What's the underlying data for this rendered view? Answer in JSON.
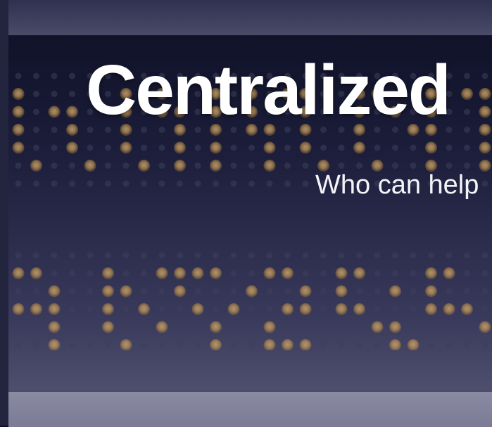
{
  "slide": {
    "title": "Centralized",
    "subtitle": "Who can help"
  },
  "colors": {
    "background_top": "#0d0f24",
    "background_bottom": "#585876",
    "led_on": "#d9a24a",
    "led_off": "#3d3f5a",
    "title_text": "#ffffff"
  }
}
